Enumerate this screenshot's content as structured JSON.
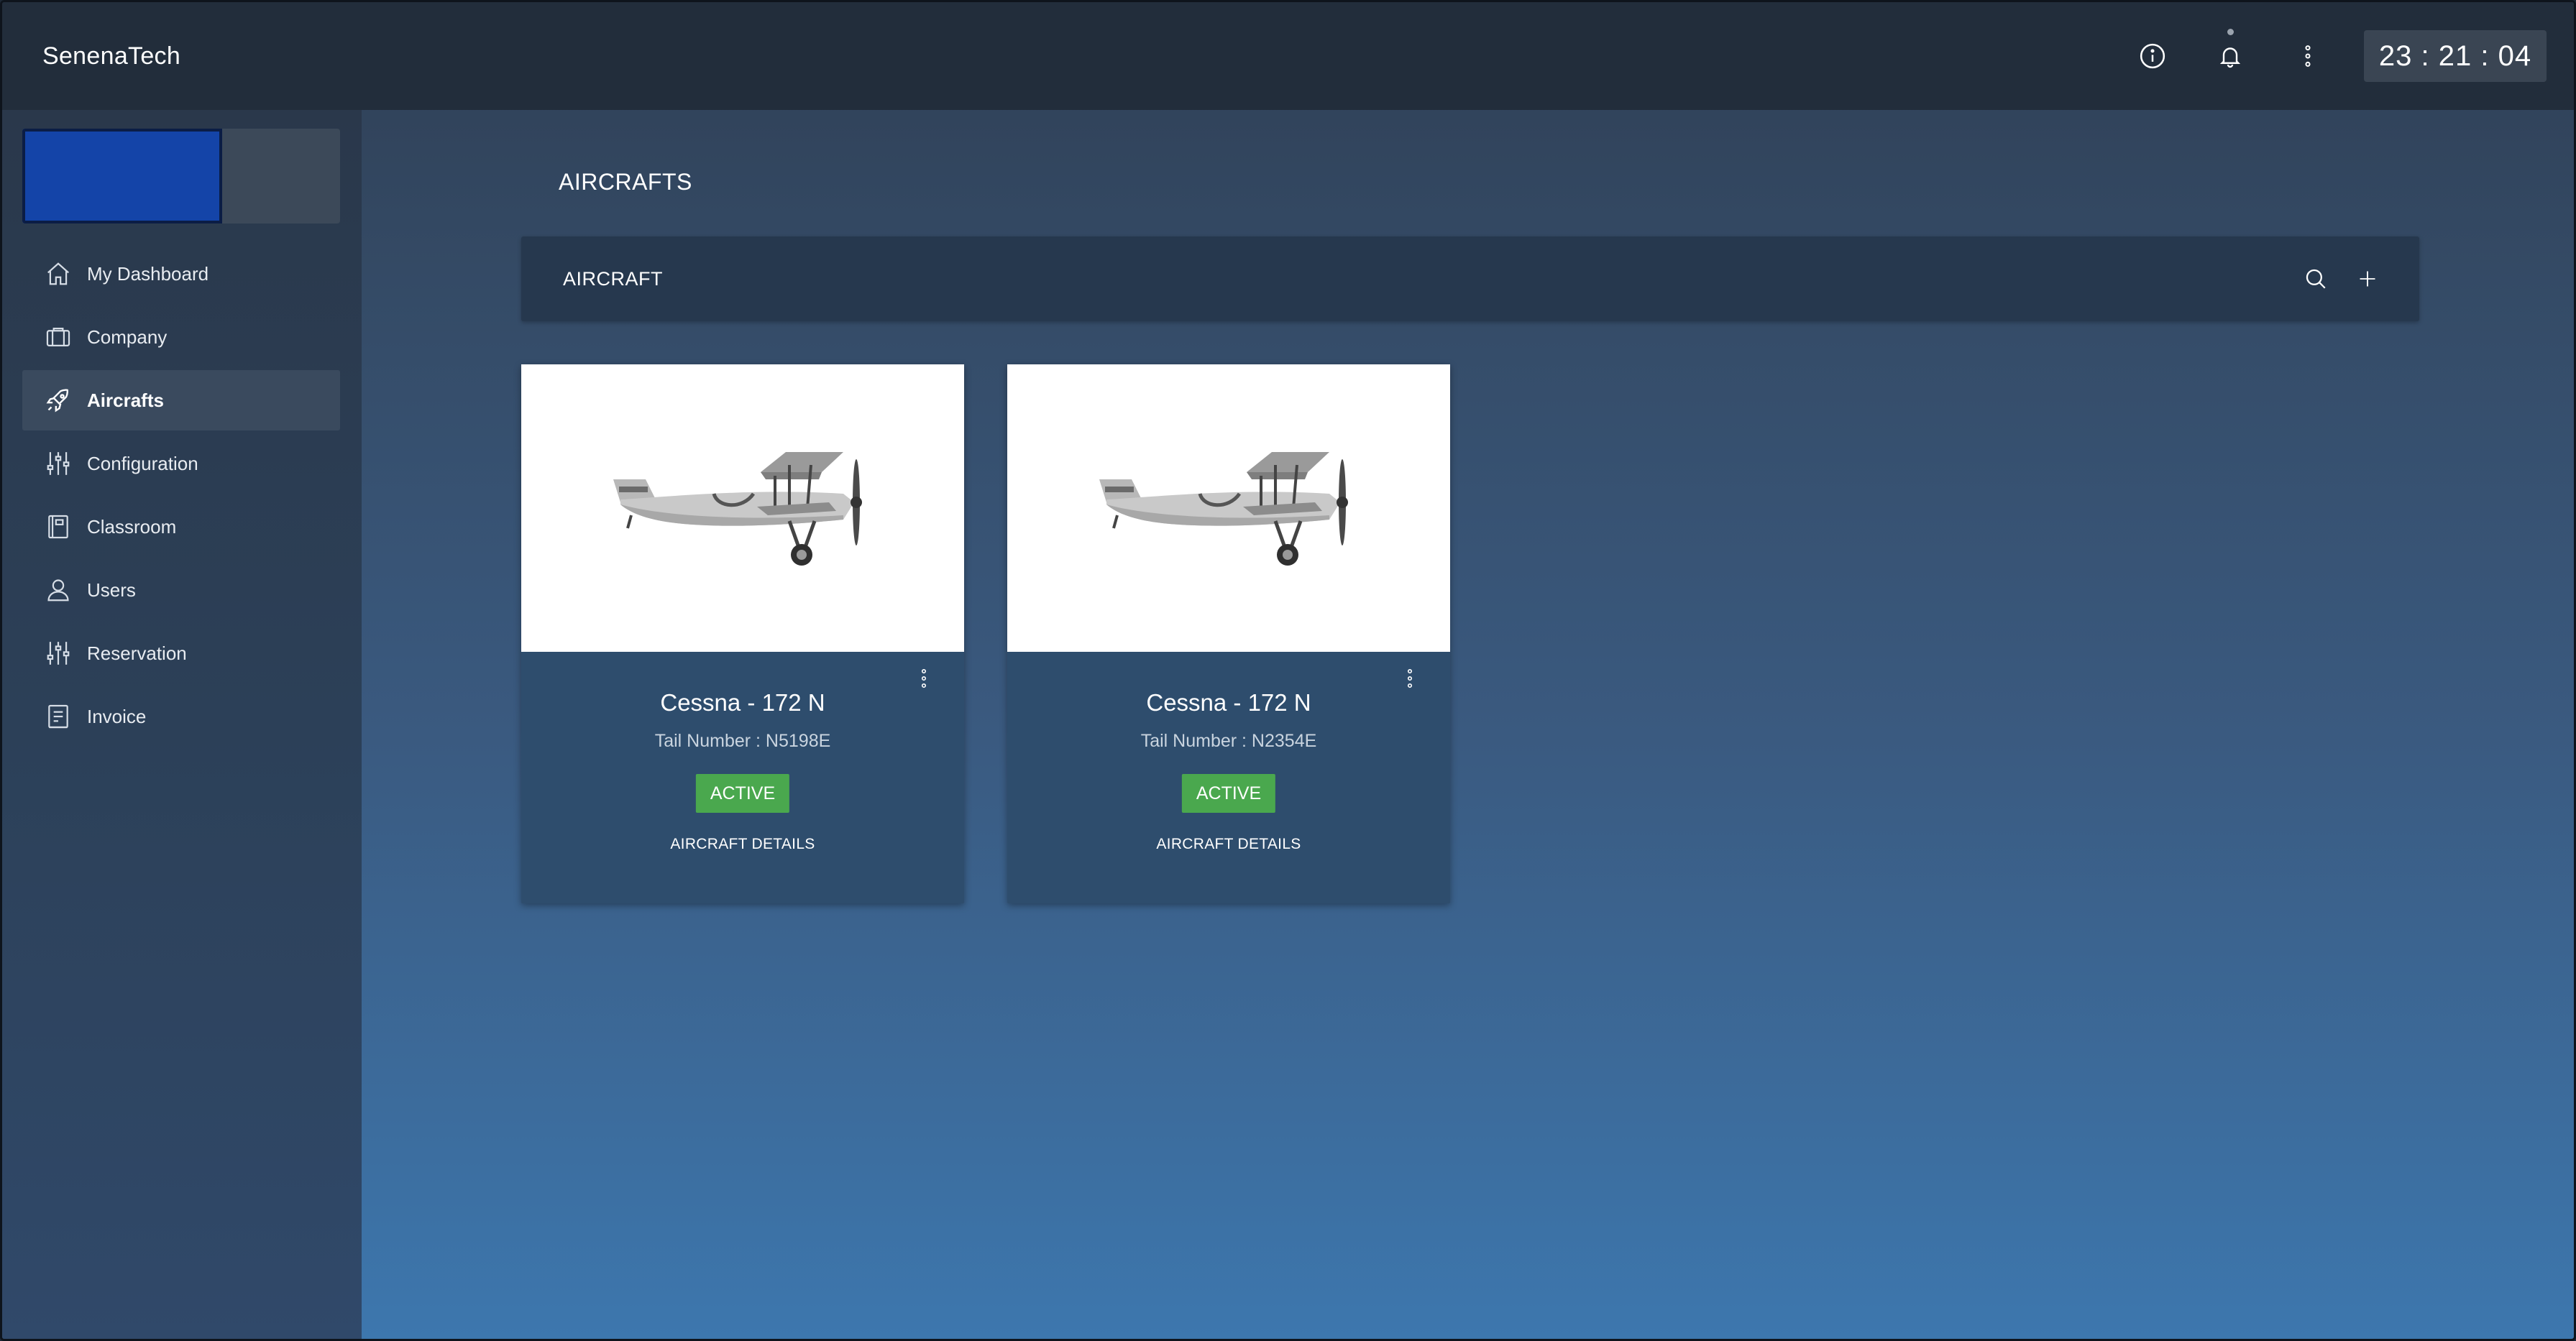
{
  "topbar": {
    "brand": "SenenaTech",
    "icons": [
      "info-icon",
      "bell-icon",
      "more-vertical-icon"
    ],
    "clock": "23 : 21 : 04"
  },
  "sidebar": {
    "items": [
      {
        "label": "My Dashboard",
        "icon": "home-icon"
      },
      {
        "label": "Company",
        "icon": "briefcase-icon"
      },
      {
        "label": "Aircrafts",
        "icon": "rocket-icon",
        "active": true
      },
      {
        "label": "Configuration",
        "icon": "sliders-icon"
      },
      {
        "label": "Classroom",
        "icon": "book-icon"
      },
      {
        "label": "Users",
        "icon": "user-icon"
      },
      {
        "label": "Reservation",
        "icon": "sliders-icon"
      },
      {
        "label": "Invoice",
        "icon": "invoice-icon"
      }
    ]
  },
  "main": {
    "page_title": "AIRCRAFTS",
    "section_title": "AIRCRAFT",
    "cards": [
      {
        "title": "Cessna - 172 N",
        "tail": "Tail Number : N5198E",
        "status": "ACTIVE",
        "details": "AIRCRAFT DETAILS"
      },
      {
        "title": "Cessna - 172 N",
        "tail": "Tail Number : N2354E",
        "status": "ACTIVE",
        "details": "AIRCRAFT DETAILS"
      }
    ]
  },
  "colors": {
    "accent_active": "#4aa84e",
    "topbar": "#222d3b",
    "profile_blue": "#1444a8"
  }
}
